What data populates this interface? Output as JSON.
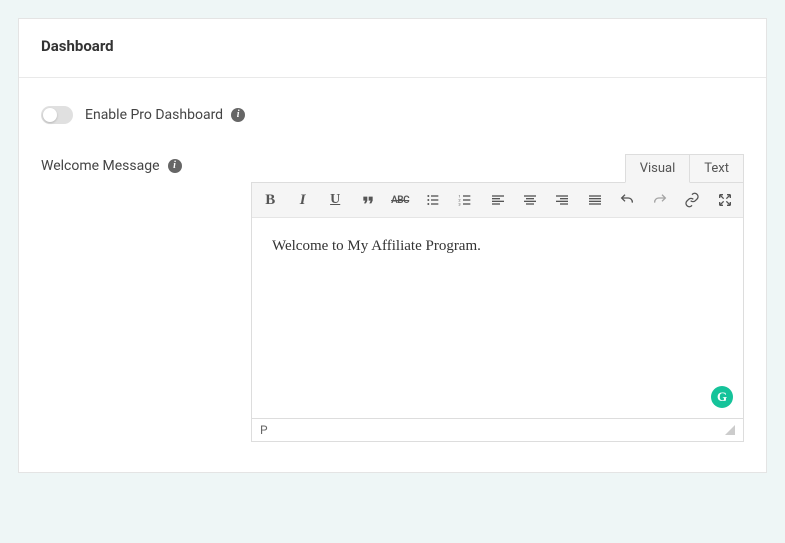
{
  "header": {
    "title": "Dashboard"
  },
  "enable_pro": {
    "label": "Enable Pro Dashboard",
    "enabled": false
  },
  "welcome": {
    "label": "Welcome Message",
    "tabs": {
      "visual": "Visual",
      "text": "Text",
      "active": "visual"
    },
    "toolbar": {
      "bold": "B",
      "italic": "I",
      "underline": "U",
      "strike": "ABC"
    },
    "content": "Welcome to My Affiliate Program.",
    "status_path": "P"
  },
  "grammarly": {
    "glyph": "G"
  }
}
